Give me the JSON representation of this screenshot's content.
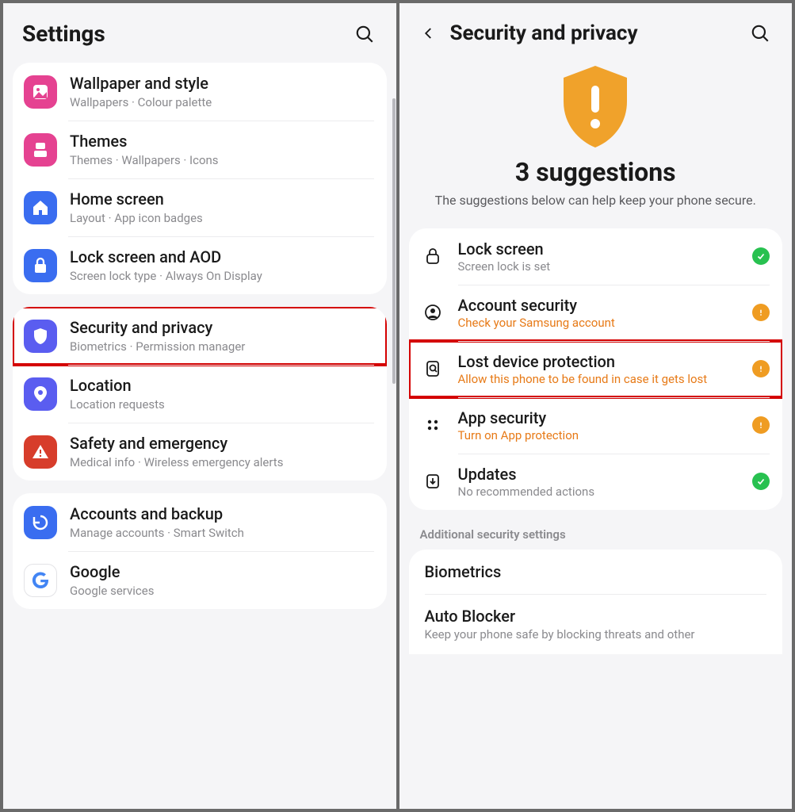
{
  "left": {
    "title": "Settings",
    "groups": [
      {
        "items": [
          {
            "title": "Wallpaper and style",
            "sub": "Wallpapers  ·  Colour palette",
            "icon": "wallpaper-icon",
            "color": "#e54291"
          },
          {
            "title": "Themes",
            "sub": "Themes  ·  Wallpapers  ·  Icons",
            "icon": "themes-icon",
            "color": "#e54291"
          },
          {
            "title": "Home screen",
            "sub": "Layout  ·  App icon badges",
            "icon": "home-icon",
            "color": "#3a6df0"
          },
          {
            "title": "Lock screen and AOD",
            "sub": "Screen lock type  ·  Always On Display",
            "icon": "lock-icon",
            "color": "#3a6df0"
          }
        ]
      },
      {
        "items": [
          {
            "title": "Security and privacy",
            "sub": "Biometrics  ·  Permission manager",
            "icon": "shield-icon",
            "color": "#5a5df0",
            "highlight": true
          },
          {
            "title": "Location",
            "sub": "Location requests",
            "icon": "location-icon",
            "color": "#5a5df0"
          },
          {
            "title": "Safety and emergency",
            "sub": "Medical info  ·  Wireless emergency alerts",
            "icon": "emergency-icon",
            "color": "#d73d2b"
          }
        ]
      },
      {
        "items": [
          {
            "title": "Accounts and backup",
            "sub": "Manage accounts  ·  Smart Switch",
            "icon": "backup-icon",
            "color": "#3a6df0"
          },
          {
            "title": "Google",
            "sub": "Google services",
            "icon": "google-icon",
            "color": "#ffffff"
          }
        ]
      }
    ]
  },
  "right": {
    "title": "Security and privacy",
    "hero_title": "3 suggestions",
    "hero_sub": "The suggestions below can help keep your phone secure.",
    "suggestions": [
      {
        "title": "Lock screen",
        "sub": "Screen lock is set",
        "status": "ok",
        "subcolor": "gray",
        "icon": "padlock-icon"
      },
      {
        "title": "Account security",
        "sub": "Check your Samsung account",
        "status": "warn",
        "subcolor": "orange",
        "icon": "account-icon"
      },
      {
        "title": "Lost device protection",
        "sub": "Allow this phone to be found in case it gets lost",
        "status": "warn",
        "subcolor": "orange",
        "icon": "find-icon",
        "highlight": true
      },
      {
        "title": "App security",
        "sub": "Turn on App protection",
        "status": "warn",
        "subcolor": "orange",
        "icon": "apps-icon"
      },
      {
        "title": "Updates",
        "sub": "No recommended actions",
        "status": "ok",
        "subcolor": "gray",
        "icon": "updates-icon"
      }
    ],
    "section_label": "Additional security settings",
    "additional": [
      {
        "title": "Biometrics",
        "sub": ""
      },
      {
        "title": "Auto Blocker",
        "sub": "Keep your phone safe by blocking threats and other"
      }
    ]
  }
}
